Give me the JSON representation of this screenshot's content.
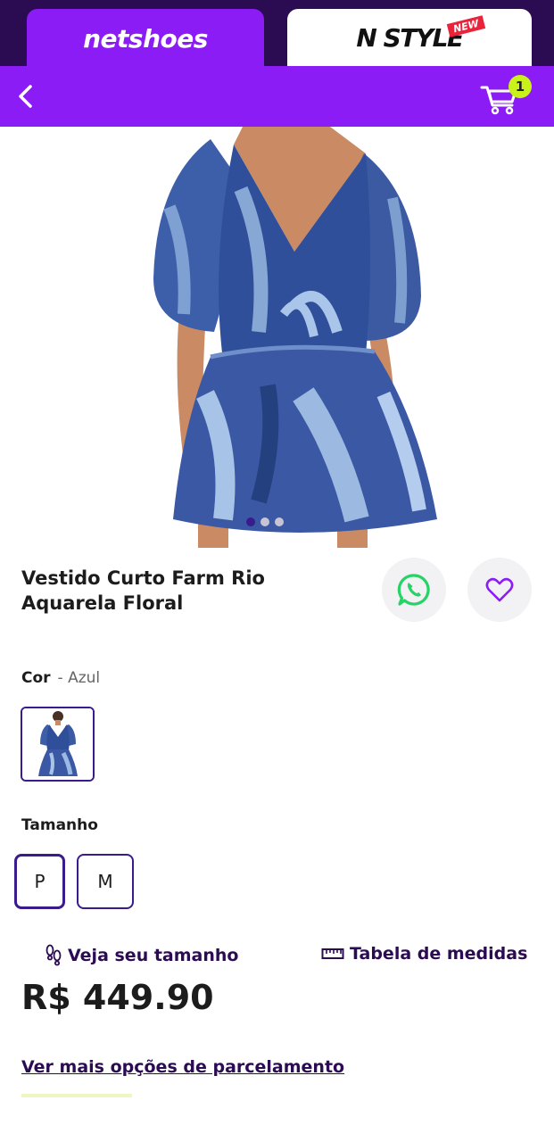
{
  "store_tabs": {
    "netshoes_label": "netshoes",
    "nstyle_label": "N STYLE",
    "nstyle_badge": "NEW"
  },
  "header": {
    "cart_count": "1",
    "back_icon": "chevron-left-icon",
    "cart_icon": "cart-icon"
  },
  "gallery": {
    "total_images": 3,
    "active_index": 0
  },
  "product": {
    "title_line1": "Vestido Curto Farm Rio",
    "title_line2": "Aquarela Floral",
    "price": "R$ 449.90"
  },
  "color": {
    "label": "Cor",
    "value": "- Azul"
  },
  "size": {
    "label": "Tamanho",
    "options": [
      "P",
      "M"
    ],
    "selected": "P"
  },
  "links": {
    "size_finder": "Veja seu tamanho",
    "size_table": "Tabela de medidas",
    "installments": "Ver mais opções de parcelamento"
  },
  "colors": {
    "brand_purple": "#8b1cf6",
    "dark_purple": "#2b0b52",
    "accent_lime": "#c9f21a",
    "whatsapp_green": "#25d366"
  }
}
